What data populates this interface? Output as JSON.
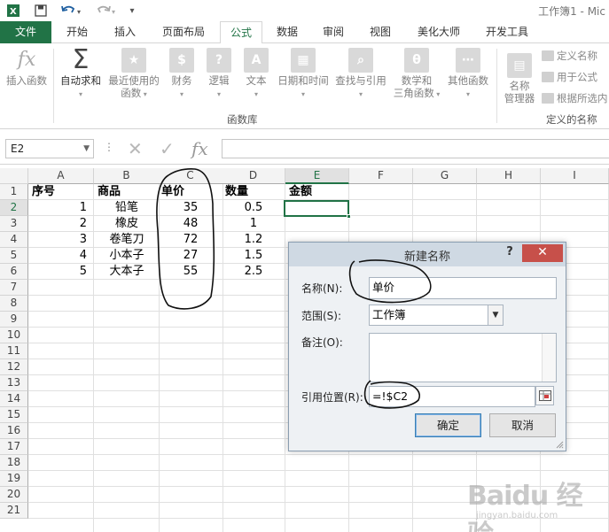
{
  "window": {
    "title": "工作簿1 - Mic"
  },
  "ribbon_tabs": [
    "文件",
    "开始",
    "插入",
    "页面布局",
    "公式",
    "数据",
    "审阅",
    "视图",
    "美化大师",
    "开发工具"
  ],
  "ribbon": {
    "insert_function": "插入函数",
    "autosum": "自动求和",
    "recent": [
      "最近使用的",
      "函数"
    ],
    "financial": "财务",
    "logical": "逻辑",
    "text": "文本",
    "datetime": "日期和时间",
    "lookup": "查找与引用",
    "mathtrig": [
      "数学和",
      "三角函数"
    ],
    "more": "其他函数",
    "library_group": "函数库",
    "name_manager": [
      "名称",
      "管理器"
    ],
    "define_name": "定义名称",
    "use_in_formula": "用于公式",
    "create_from_selection": "根据所选内",
    "defined_names_group": "定义的名称"
  },
  "formula_bar": {
    "name_box": "E2",
    "formula": "",
    "fx": "fx"
  },
  "sheet": {
    "columns": [
      "A",
      "B",
      "C",
      "D",
      "E",
      "F",
      "G",
      "H",
      "I"
    ],
    "rows": [
      "1",
      "2",
      "3",
      "4",
      "5",
      "6",
      "7",
      "8",
      "9",
      "10",
      "11",
      "12",
      "13",
      "14",
      "15",
      "16",
      "17",
      "18",
      "19",
      "20",
      "21"
    ],
    "headers": {
      "A": "序号",
      "B": "商品",
      "C": "单价",
      "D": "数量",
      "E": "金额"
    },
    "data": [
      {
        "A": "1",
        "B": "铅笔",
        "C": "35",
        "D": "0.5"
      },
      {
        "A": "2",
        "B": "橡皮",
        "C": "48",
        "D": "1"
      },
      {
        "A": "3",
        "B": "卷笔刀",
        "C": "72",
        "D": "1.2"
      },
      {
        "A": "4",
        "B": "小本子",
        "C": "27",
        "D": "1.5"
      },
      {
        "A": "5",
        "B": "大本子",
        "C": "55",
        "D": "2.5"
      }
    ],
    "selected_cell": "E2"
  },
  "dialog": {
    "title": "新建名称",
    "help": "?",
    "close": "✕",
    "name_label": "名称(N):",
    "name_value": "单价",
    "scope_label": "范围(S):",
    "scope_value": "工作簿",
    "comment_label": "备注(O):",
    "comment_value": "",
    "ref_label": "引用位置(R):",
    "ref_value": "=!$C2",
    "ok": "确定",
    "cancel": "取消"
  },
  "watermark": {
    "logo": "Baidu 经验",
    "sub": "jingyan.baidu.com"
  },
  "colors": {
    "excel_green": "#217346",
    "close_red": "#c7504a",
    "dialog_bg": "#eef1f4"
  }
}
